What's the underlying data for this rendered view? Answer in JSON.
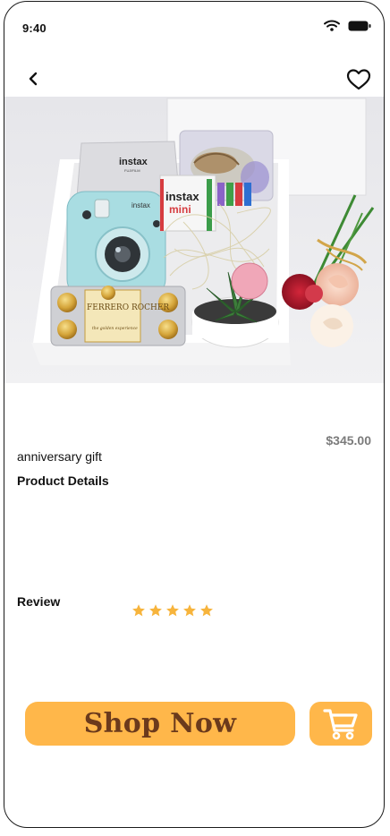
{
  "status_bar": {
    "time": "9:40"
  },
  "nav": {
    "back_icon": "chevron-left-icon",
    "favorite_icon": "heart-outline-icon"
  },
  "hero": {
    "box_texts": {
      "instax_film": "instax",
      "instax_brand": "FUJIFILM",
      "camera_label": "instax",
      "instax_mini": "instax",
      "mini": "mini",
      "chocolate_brand": "FERRERO ROCHER",
      "chocolate_tagline": "the golden experience"
    }
  },
  "product": {
    "name": "anniversary gift",
    "price": "$345.00",
    "details_heading": "Product Details",
    "review_heading": "Review",
    "rating": 5,
    "rating_max": 5
  },
  "actions": {
    "shop_label": "Shop Now",
    "cart_icon": "cart-icon"
  },
  "colors": {
    "accent": "#ffb74a",
    "button_text": "#6b3a1c",
    "star": "#f7b43c",
    "price": "#7b7b7b"
  }
}
